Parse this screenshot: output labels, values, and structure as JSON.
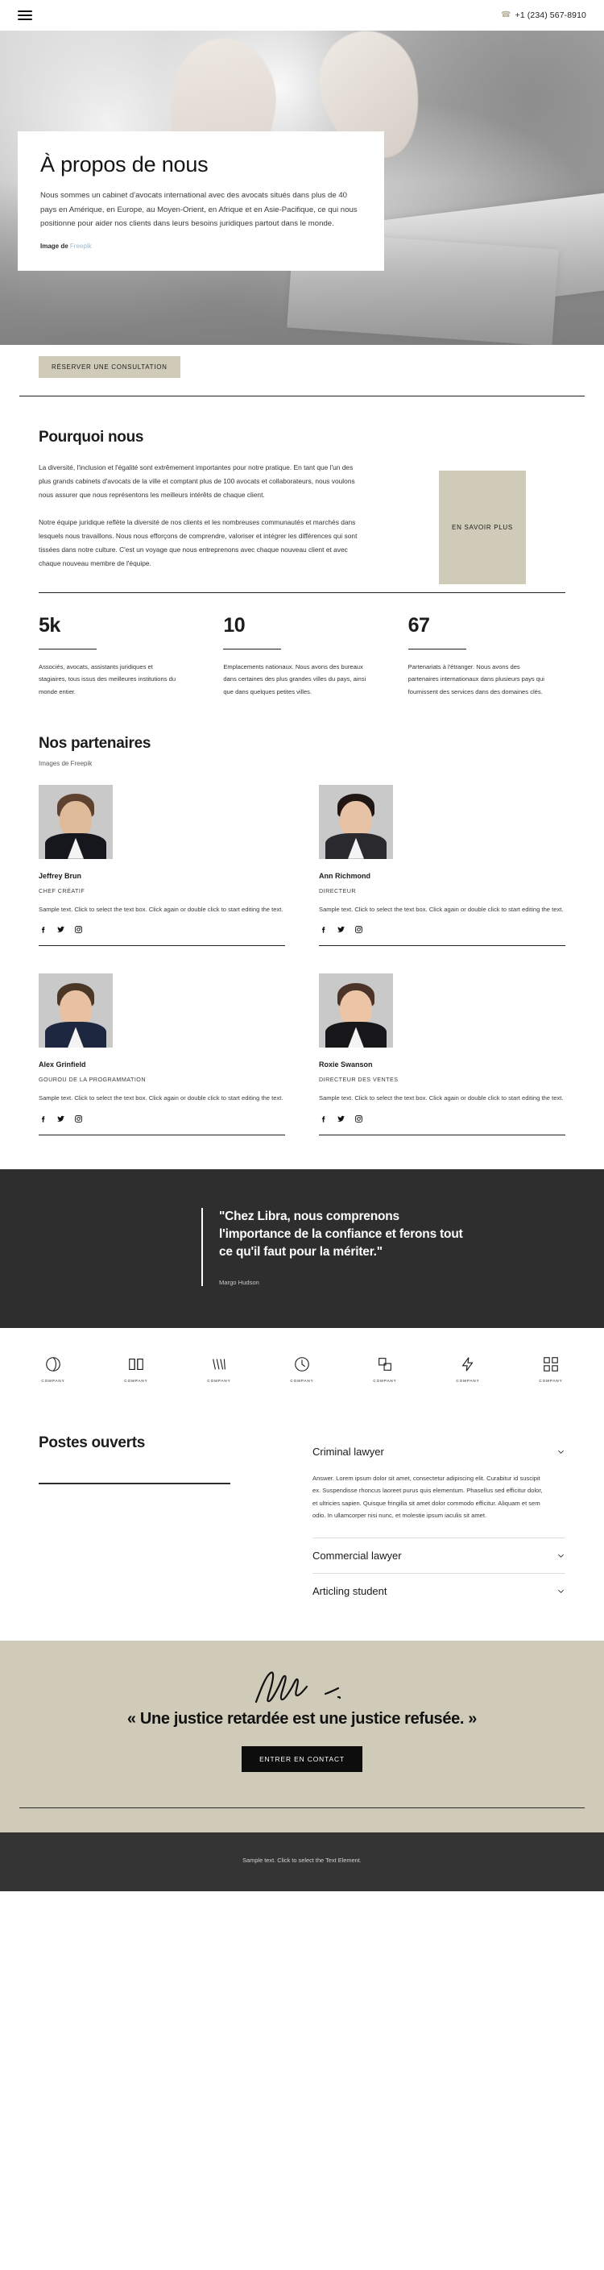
{
  "header": {
    "menu_icon": "hamburger-menu-icon",
    "phone_icon": "phone-icon",
    "phone": "+1 (234) 567-8910"
  },
  "hero": {
    "title": "À propos de nous",
    "paragraph": "Nous sommes un cabinet d'avocats international avec des avocats situés dans plus de 40 pays en Amérique, en Europe, au Moyen-Orient, en Afrique et en Asie-Pacifique, ce qui nous positionne pour aider nos clients dans leurs besoins juridiques partout dans le monde.",
    "credit_label": "Image de",
    "credit_link": "Freepik",
    "cta_label": "RÉSERVER UNE CONSULTATION"
  },
  "why": {
    "title": "Pourquoi nous",
    "paragraph1": "La diversité, l'inclusion et l'égalité sont extrêmement importantes pour notre pratique. En tant que l'un des plus grands cabinets d'avocats de la ville et comptant plus de 100 avocats et collaborateurs, nous voulons nous assurer que nous représentons les meilleurs intérêts de chaque client.",
    "paragraph2": "Notre équipe juridique reflète la diversité de nos clients et les nombreuses communautés et marchés dans lesquels nous travaillons. Nous nous efforçons de comprendre, valoriser et intégrer les différences qui sont tissées dans notre culture. C'est un voyage que nous entreprenons avec chaque nouveau client et avec chaque nouveau membre de l'équipe.",
    "cta_label": "EN SAVOIR PLUS"
  },
  "stats": [
    {
      "number": "5k",
      "text": "Associés, avocats, assistants juridiques et stagiaires, tous issus des meilleures institutions du monde entier."
    },
    {
      "number": "10",
      "text": "Emplacements nationaux. Nous avons des bureaux dans certaines des plus grandes villes du pays, ainsi que dans quelques petites villes."
    },
    {
      "number": "67",
      "text": "Partenariats à l'étranger. Nous avons des partenaires internationaux dans plusieurs pays qui fournissent des services dans des domaines clés."
    }
  ],
  "partners": {
    "title": "Nos partenaires",
    "subtitle": "Images de Freepik",
    "members": [
      {
        "name": "Jeffrey Brun",
        "role": "CHEF CRÉATIF",
        "desc": "Sample text. Click to select the text box. Click again or double click to start editing the text."
      },
      {
        "name": "Ann Richmond",
        "role": "DIRECTEUR",
        "desc": "Sample text. Click to select the text box. Click again or double click to start editing the text."
      },
      {
        "name": "Alex Grinfield",
        "role": "GOUROU DE LA PROGRAMMATION",
        "desc": "Sample text. Click to select the text box. Click again or double click to start editing the text."
      },
      {
        "name": "Roxie Swanson",
        "role": "DIRECTEUR DES VENTES",
        "desc": "Sample text. Click to select the text box. Click again or double click to start editing the text."
      }
    ],
    "social_icons": [
      "facebook-icon",
      "twitter-icon",
      "instagram-icon"
    ]
  },
  "quote": {
    "text": "\"Chez Libra, nous comprenons l'importance de la confiance et ferons tout ce qu'il faut pour la mériter.\"",
    "author": "Margo Hudson"
  },
  "logos": [
    {
      "caption": "COMPANY",
      "icon": "circle-swirl-logo-icon"
    },
    {
      "caption": "COMPANY",
      "icon": "open-book-logo-icon"
    },
    {
      "caption": "COMPANY",
      "icon": "crown-lines-logo-icon"
    },
    {
      "caption": "COMPANY",
      "icon": "shield-circle-logo-icon"
    },
    {
      "caption": "COMPANY",
      "icon": "squares-logo-icon"
    },
    {
      "caption": "COMPANY",
      "icon": "bolt-logo-icon"
    },
    {
      "caption": "COMPANY",
      "icon": "brackets-logo-icon"
    }
  ],
  "jobs": {
    "title": "Postes ouverts",
    "items": [
      {
        "label": "Criminal lawyer",
        "expanded": true,
        "body": "Answer. Lorem ipsum dolor sit amet, consectetur adipiscing elit. Curabitur id suscipit ex. Suspendisse rhoncus laoreet purus quis elementum. Phasellus sed efficitur dolor, et ultricies sapien. Quisque fringilla sit amet dolor commodo efficitur. Aliquam et sem odio. In ullamcorper nisi nunc, et molestie ipsum iaculis sit amet."
      },
      {
        "label": "Commercial lawyer",
        "expanded": false,
        "body": ""
      },
      {
        "label": "Articling student",
        "expanded": false,
        "body": ""
      }
    ]
  },
  "cta": {
    "signature_icon": "handwritten-signature-icon",
    "headline": "« Une justice retardée est une justice refusée. »",
    "button_label": "ENTRER EN CONTACT"
  },
  "footer": {
    "text": "Sample text. Click to select the Text Element."
  },
  "colors": {
    "sand": "#cfcbb8",
    "dark": "#2e2e2e",
    "footer_dark": "#343434",
    "text": "#1c1c1c",
    "link_blue": "#9fb6c9"
  }
}
